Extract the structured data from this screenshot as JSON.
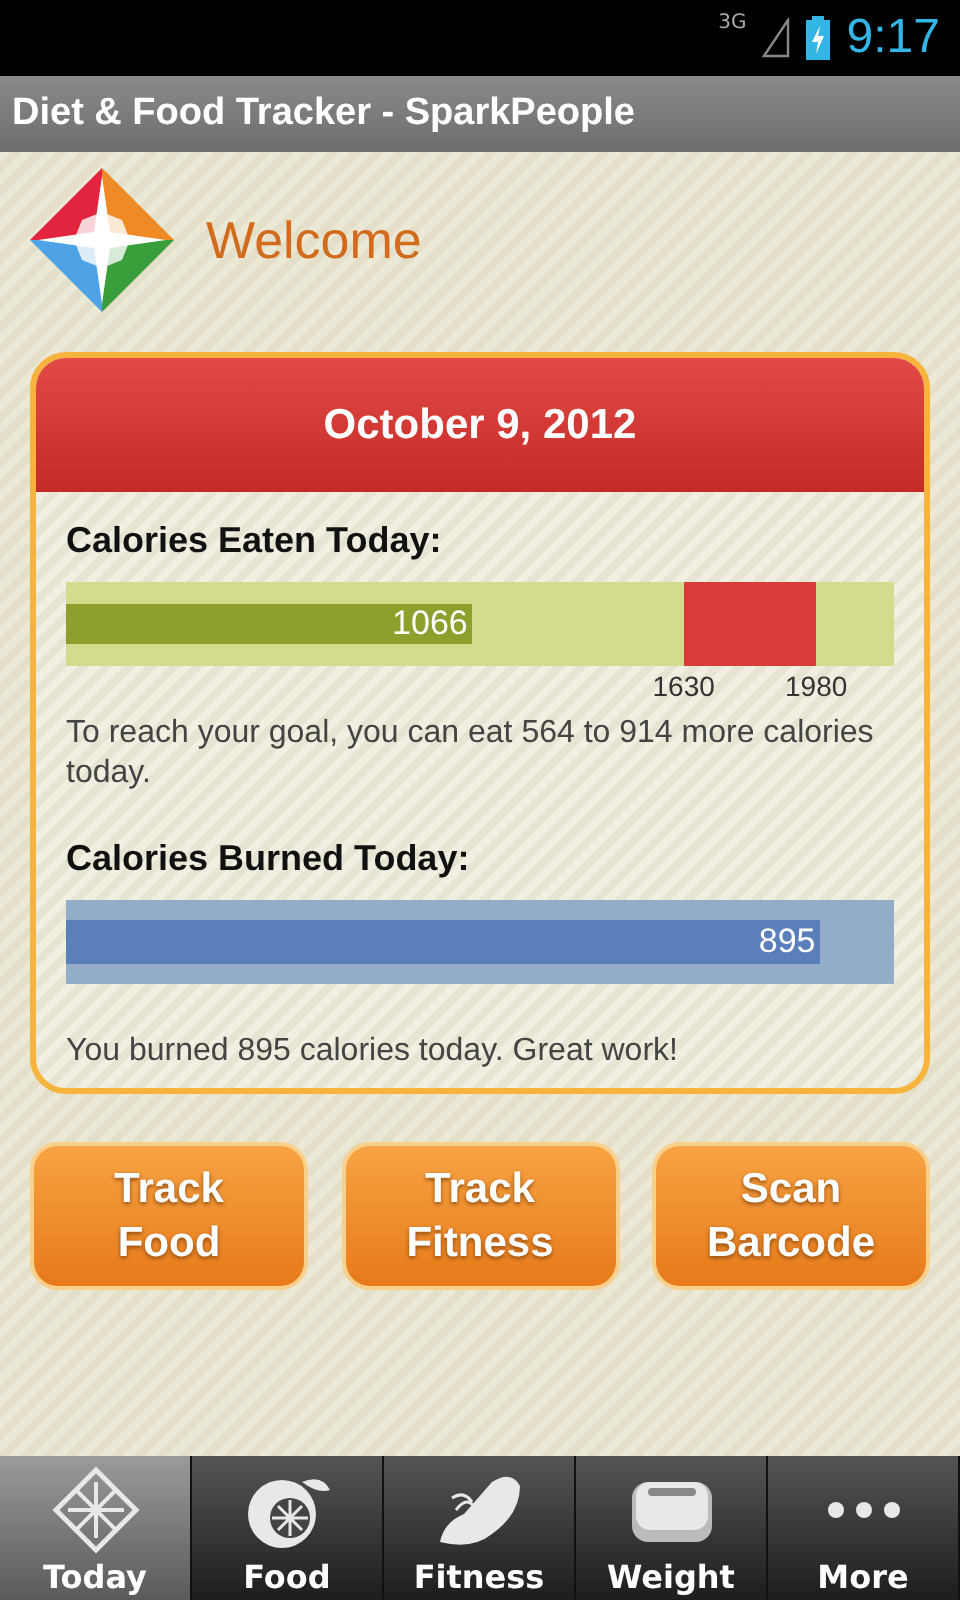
{
  "status_bar": {
    "network": "3G",
    "time": "9:17"
  },
  "window": {
    "title": "Diet & Food Tracker - SparkPeople"
  },
  "welcome": "Welcome",
  "card": {
    "date": "October 9, 2012",
    "eaten": {
      "label": "Calories Eaten Today:",
      "value": "1066",
      "level": 0.49,
      "goal_min": "1630",
      "goal_max": "1980",
      "message": "To reach your goal, you can eat 564 to 914 more calories today."
    },
    "burned": {
      "label": "Calories Burned Today:",
      "value": "895",
      "level": 0.91,
      "message": "You burned 895 calories today. Great work!"
    }
  },
  "buttons": [
    {
      "label": "Track Food"
    },
    {
      "label": "Track Fitness"
    },
    {
      "label": "Scan Barcode"
    }
  ],
  "tabs": [
    {
      "kind": "today",
      "label": "Today",
      "selected": true
    },
    {
      "kind": "food",
      "label": "Food",
      "selected": false
    },
    {
      "kind": "fitness",
      "label": "Fitness",
      "selected": false
    },
    {
      "kind": "weight",
      "label": "Weight",
      "selected": false
    },
    {
      "kind": "more",
      "label": "More",
      "selected": false
    }
  ]
}
